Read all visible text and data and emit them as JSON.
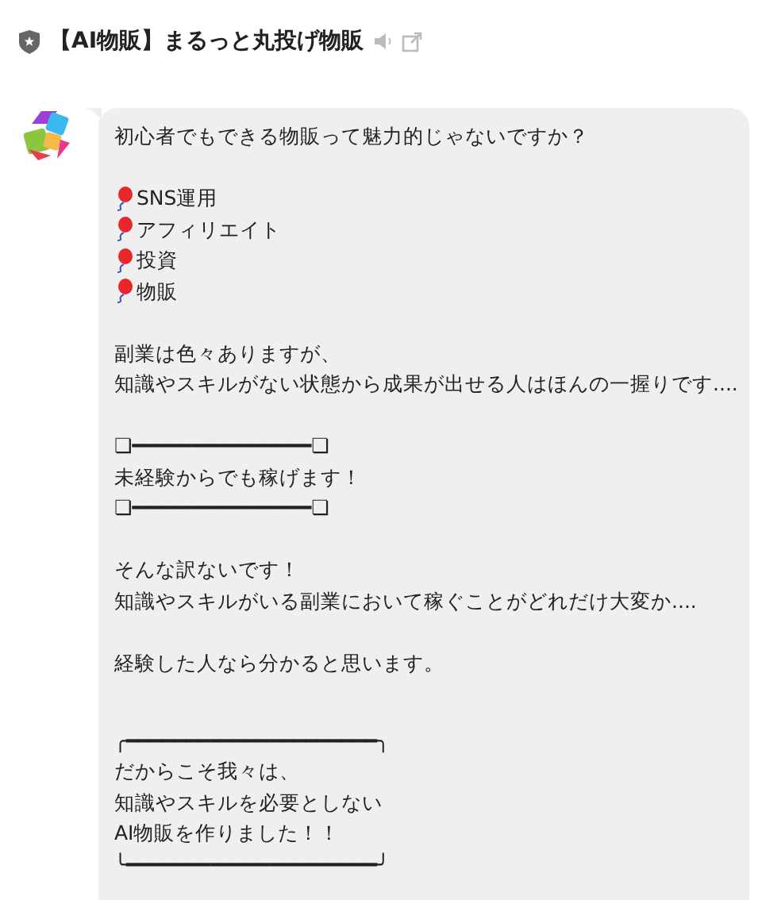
{
  "header": {
    "title": "【AI物販】まるっと丸投げ物販"
  },
  "message": {
    "blocks": [
      {
        "kind": "text",
        "lines": [
          "初心者でもできる物販って魅力的じゃないですか？"
        ]
      },
      {
        "kind": "bullets",
        "lines": [
          "SNS運用",
          "アフィリエイト",
          "投資",
          "物販"
        ]
      },
      {
        "kind": "text",
        "lines": [
          "副業は色々ありますが、",
          "知識やスキルがない状態から成果が出せる人はほんの一握りです...."
        ]
      },
      {
        "kind": "text",
        "lines": [
          "❏━━━━━━━━━━━━━━━❏",
          "未経験からでも稼げます！",
          "❏━━━━━━━━━━━━━━━❏"
        ]
      },
      {
        "kind": "text",
        "lines": [
          "そんな訳ないです！",
          "知識やスキルがいる副業において稼ぐことがどれだけ大変か...."
        ]
      },
      {
        "kind": "text",
        "lines": [
          "経験した人なら分かると思います。"
        ]
      },
      {
        "kind": "framed",
        "top": "╭━━━━━━━━━━━━━━━━━━━━━╮",
        "lines": [
          "だからこそ我々は、",
          "知識やスキルを必要としない",
          "AI物販を作りました！！"
        ],
        "bottom": "╰━━━━━━━━━━━━━━━━━━━━━╯"
      }
    ]
  }
}
